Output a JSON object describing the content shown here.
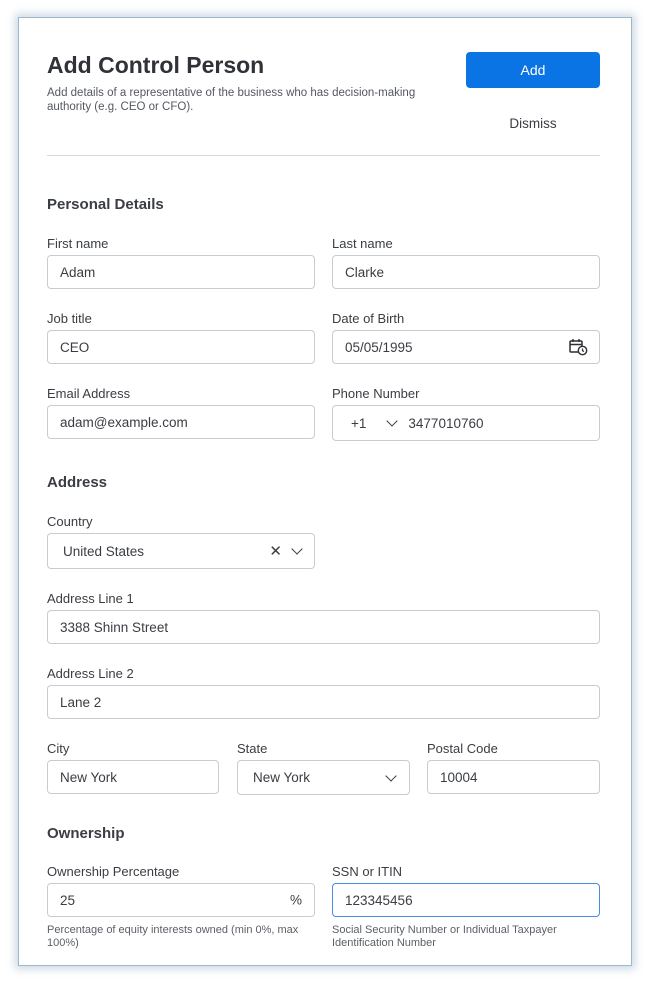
{
  "header": {
    "title": "Add Control Person",
    "subtitle": "Add details of a representative of the business who has decision-making authority (e.g. CEO or CFO).",
    "add_label": "Add",
    "dismiss_label": "Dismiss"
  },
  "personal": {
    "heading": "Personal Details",
    "first_name": {
      "label": "First name",
      "value": "Adam"
    },
    "last_name": {
      "label": "Last name",
      "value": "Clarke"
    },
    "job_title": {
      "label": "Job title",
      "value": "CEO"
    },
    "dob": {
      "label": "Date of Birth",
      "value": "05/05/1995",
      "icon": "calendar-clock-icon"
    },
    "email": {
      "label": "Email Address",
      "value": "adam@example.com"
    },
    "phone": {
      "label": "Phone Number",
      "country_code": "+1",
      "value": "3477010760"
    }
  },
  "address": {
    "heading": "Address",
    "country": {
      "label": "Country",
      "value": "United States"
    },
    "line1": {
      "label": "Address Line 1",
      "value": "3388 Shinn Street"
    },
    "line2": {
      "label": "Address Line 2",
      "value": "Lane 2"
    },
    "city": {
      "label": "City",
      "value": "New York"
    },
    "state": {
      "label": "State",
      "value": "New York"
    },
    "postal": {
      "label": "Postal Code",
      "value": "10004"
    }
  },
  "ownership": {
    "heading": "Ownership",
    "percentage": {
      "label": "Ownership Percentage",
      "value": "25",
      "suffix": "%",
      "helper": "Percentage of equity interests owned (min 0%, max 100%)"
    },
    "ssn": {
      "label": "SSN or ITIN",
      "value": "123345456",
      "helper": "Social Security Number or Individual Taxpayer Identification Number"
    }
  },
  "colors": {
    "accent": "#0b74e4",
    "border": "#c8ccd1",
    "focus_border": "#4a8ae0",
    "text": "#3a3d42"
  }
}
